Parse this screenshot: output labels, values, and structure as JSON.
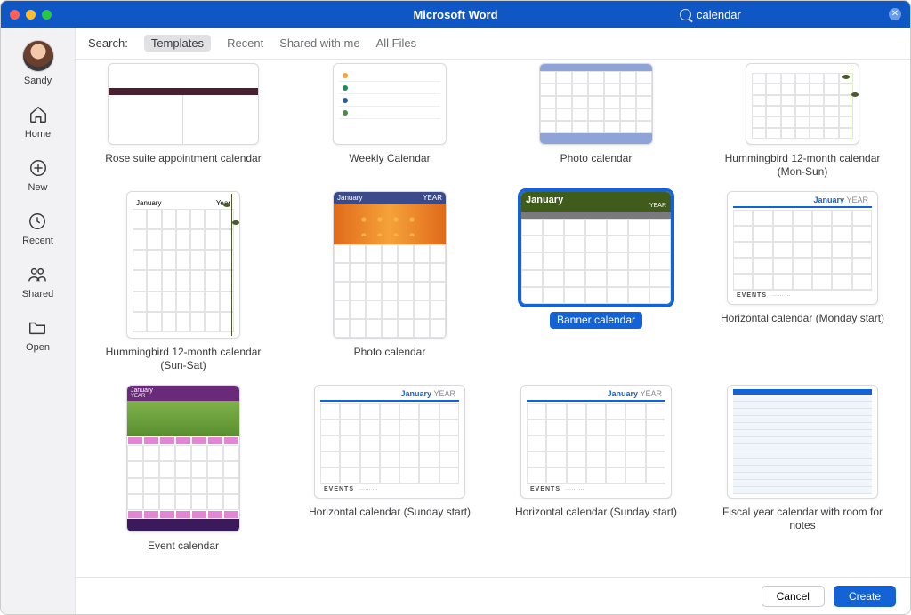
{
  "window": {
    "title": "Microsoft Word"
  },
  "search": {
    "value": "calendar"
  },
  "user": {
    "name": "Sandy"
  },
  "sidebar": [
    {
      "id": "home",
      "label": "Home"
    },
    {
      "id": "new",
      "label": "New"
    },
    {
      "id": "recent",
      "label": "Recent"
    },
    {
      "id": "shared",
      "label": "Shared"
    },
    {
      "id": "open",
      "label": "Open"
    }
  ],
  "filters": {
    "label": "Search:",
    "items": [
      {
        "label": "Templates",
        "active": true
      },
      {
        "label": "Recent",
        "active": false
      },
      {
        "label": "Shared with me",
        "active": false
      },
      {
        "label": "All Files",
        "active": false
      }
    ]
  },
  "templates": [
    {
      "label": "Rose suite appointment calendar",
      "orient": "landscape",
      "kind": "rose"
    },
    {
      "label": "Weekly Calendar",
      "orient": "portrait",
      "kind": "weekly"
    },
    {
      "label": "Photo calendar",
      "orient": "portrait",
      "kind": "photoA"
    },
    {
      "label": "Hummingbird 12-month calendar (Mon-Sun)",
      "orient": "portrait",
      "kind": "humming"
    },
    {
      "label": "Hummingbird 12-month calendar (Sun-Sat)",
      "orient": "portrait",
      "kind": "humming",
      "header": {
        "left": "January",
        "right": "Year"
      }
    },
    {
      "label": "Photo calendar",
      "orient": "portrait",
      "kind": "photoB",
      "header": {
        "left": "January",
        "right": "YEAR"
      }
    },
    {
      "label": "Banner calendar",
      "orient": "landscape",
      "kind": "banner",
      "selected": true,
      "header": {
        "left": "January",
        "right": "YEAR"
      }
    },
    {
      "label": "Horizontal calendar (Monday start)",
      "orient": "landscape",
      "kind": "hcal",
      "header": {
        "left": "January",
        "right": "YEAR"
      },
      "events": "EVENTS"
    },
    {
      "label": "Event calendar",
      "orient": "portrait",
      "kind": "event",
      "header": {
        "left": "January",
        "right": "YEAR"
      }
    },
    {
      "label": "Horizontal calendar (Sunday start)",
      "orient": "landscape",
      "kind": "hcal",
      "header": {
        "left": "January",
        "right": "YEAR"
      },
      "events": "EVENTS"
    },
    {
      "label": "Horizontal calendar (Sunday start)",
      "orient": "landscape",
      "kind": "hcal",
      "header": {
        "left": "January",
        "right": "YEAR"
      },
      "events": "EVENTS"
    },
    {
      "label": "Fiscal year calendar with room for notes",
      "orient": "landscape",
      "kind": "fiscal"
    }
  ],
  "footer": {
    "cancel": "Cancel",
    "create": "Create"
  }
}
